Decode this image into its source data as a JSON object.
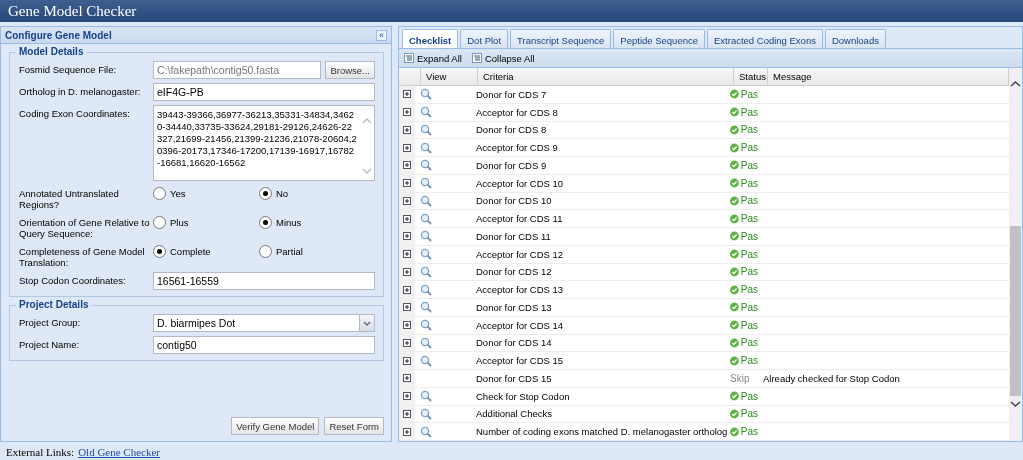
{
  "window": {
    "title": "Gene Model Checker"
  },
  "left_panel": {
    "title": "Configure Gene Model",
    "collapse_button": "«",
    "model_details": {
      "legend": "Model Details",
      "fields": [
        {
          "kind": "file",
          "label": "Fosmid Sequence File:",
          "value": "C:\\fakepath\\contig50.fasta",
          "button": "Browse..."
        },
        {
          "kind": "text",
          "label": "Ortholog in D. melanogaster:",
          "value": "eIF4G-PB"
        },
        {
          "kind": "textarea",
          "label": "Coding Exon Coordinates:",
          "value": "39443-39366,36977-36213,35331-34834,34620-34440,33735-33624,29181-29126,24626-22327,21699-21456,21399-21236,21078-20604,20396-20173,17346-17200,17139-16917,16782-16681,16620-16562"
        },
        {
          "kind": "radio",
          "label": "Annotated Untranslated Regions?",
          "options": [
            {
              "label": "Yes",
              "selected": false
            },
            {
              "label": "No",
              "selected": true
            }
          ]
        },
        {
          "kind": "radio",
          "label": "Orientation of Gene Relative to Query Sequence:",
          "options": [
            {
              "label": "Plus",
              "selected": false
            },
            {
              "label": "Minus",
              "selected": true
            }
          ]
        },
        {
          "kind": "radio",
          "label": "Completeness of Gene Model Translation:",
          "options": [
            {
              "label": "Complete",
              "selected": true
            },
            {
              "label": "Partial",
              "selected": false
            }
          ]
        },
        {
          "kind": "text",
          "label": "Stop Codon Coordinates:",
          "value": "16561-16559"
        }
      ]
    },
    "project_details": {
      "legend": "Project Details",
      "fields": [
        {
          "kind": "select",
          "label": "Project Group:",
          "value": "D. biarmipes Dot"
        },
        {
          "kind": "text",
          "label": "Project Name:",
          "value": "contig50"
        }
      ]
    },
    "buttons": [
      "Verify Gene Model",
      "Reset Form"
    ]
  },
  "tabs": [
    {
      "label": "Checklist",
      "selected": true
    },
    {
      "label": "Dot Plot",
      "selected": false
    },
    {
      "label": "Transcript Sequence",
      "selected": false
    },
    {
      "label": "Peptide Sequence",
      "selected": false
    },
    {
      "label": "Extracted Coding Exons",
      "selected": false
    },
    {
      "label": "Downloads",
      "selected": false
    }
  ],
  "toolbar": [
    "Expand All",
    "Collapse All"
  ],
  "table": {
    "columns": [
      "View",
      "Criteria",
      "Status",
      "Message"
    ],
    "rows": [
      {
        "criteria": "Donor for CDS 7",
        "status": "Pas",
        "kind": "pass",
        "view": true
      },
      {
        "criteria": "Acceptor for CDS 8",
        "status": "Pas",
        "kind": "pass",
        "view": true
      },
      {
        "criteria": "Donor for CDS 8",
        "status": "Pas",
        "kind": "pass",
        "view": true
      },
      {
        "criteria": "Acceptor for CDS 9",
        "status": "Pas",
        "kind": "pass",
        "view": true
      },
      {
        "criteria": "Donor for CDS 9",
        "status": "Pas",
        "kind": "pass",
        "view": true
      },
      {
        "criteria": "Acceptor for CDS 10",
        "status": "Pas",
        "kind": "pass",
        "view": true
      },
      {
        "criteria": "Donor for CDS 10",
        "status": "Pas",
        "kind": "pass",
        "view": true
      },
      {
        "criteria": "Acceptor for CDS 11",
        "status": "Pas",
        "kind": "pass",
        "view": true
      },
      {
        "criteria": "Donor for CDS 11",
        "status": "Pas",
        "kind": "pass",
        "view": true
      },
      {
        "criteria": "Acceptor for CDS 12",
        "status": "Pas",
        "kind": "pass",
        "view": true
      },
      {
        "criteria": "Donor for CDS 12",
        "status": "Pas",
        "kind": "pass",
        "view": true
      },
      {
        "criteria": "Acceptor for CDS 13",
        "status": "Pas",
        "kind": "pass",
        "view": true
      },
      {
        "criteria": "Donor for CDS 13",
        "status": "Pas",
        "kind": "pass",
        "view": true
      },
      {
        "criteria": "Acceptor for CDS 14",
        "status": "Pas",
        "kind": "pass",
        "view": true
      },
      {
        "criteria": "Donor for CDS 14",
        "status": "Pas",
        "kind": "pass",
        "view": true
      },
      {
        "criteria": "Acceptor for CDS 15",
        "status": "Pas",
        "kind": "pass",
        "view": true
      },
      {
        "criteria": "Donor for CDS 15",
        "status": "Skip",
        "kind": "skip",
        "view": false,
        "message": "Already checked for Stop Codon"
      },
      {
        "criteria": "Check for Stop Codon",
        "status": "Pas",
        "kind": "pass",
        "view": true
      },
      {
        "criteria": "Additional Checks",
        "status": "Pas",
        "kind": "pass",
        "view": true
      },
      {
        "criteria": "Number of coding exons matched D. melanogaster ortholog",
        "status": "Pas",
        "kind": "pass",
        "view": true
      }
    ]
  },
  "footer": {
    "label": "External Links:",
    "link": "Old Gene Checker"
  }
}
